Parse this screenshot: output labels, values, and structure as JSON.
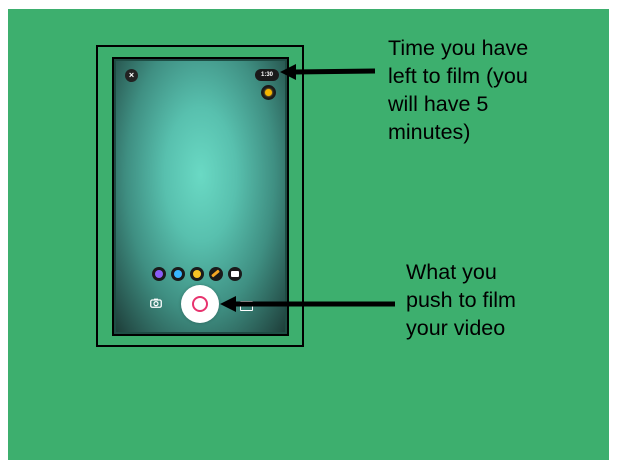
{
  "camera": {
    "close_glyph": "×",
    "timer": "1:30",
    "tools": [
      {
        "icon": "purple-filter-icon",
        "color": "#8a5cf6"
      },
      {
        "icon": "blue-filter-icon",
        "color": "#38b6ff"
      },
      {
        "icon": "emoji-icon",
        "color": "#f7c325"
      },
      {
        "icon": "pen-icon",
        "color": "#f5a623"
      },
      {
        "icon": "sticker-icon",
        "color": "#ffffff"
      }
    ],
    "record_color": "#e8336e"
  },
  "annotations": {
    "timer_note": "Time you have\nleft to film (you\nwill have 5\nminutes)",
    "record_note": "What you\npush to film\nyour video"
  },
  "colors": {
    "background": "#3daf6e",
    "arrow": "#000000"
  }
}
